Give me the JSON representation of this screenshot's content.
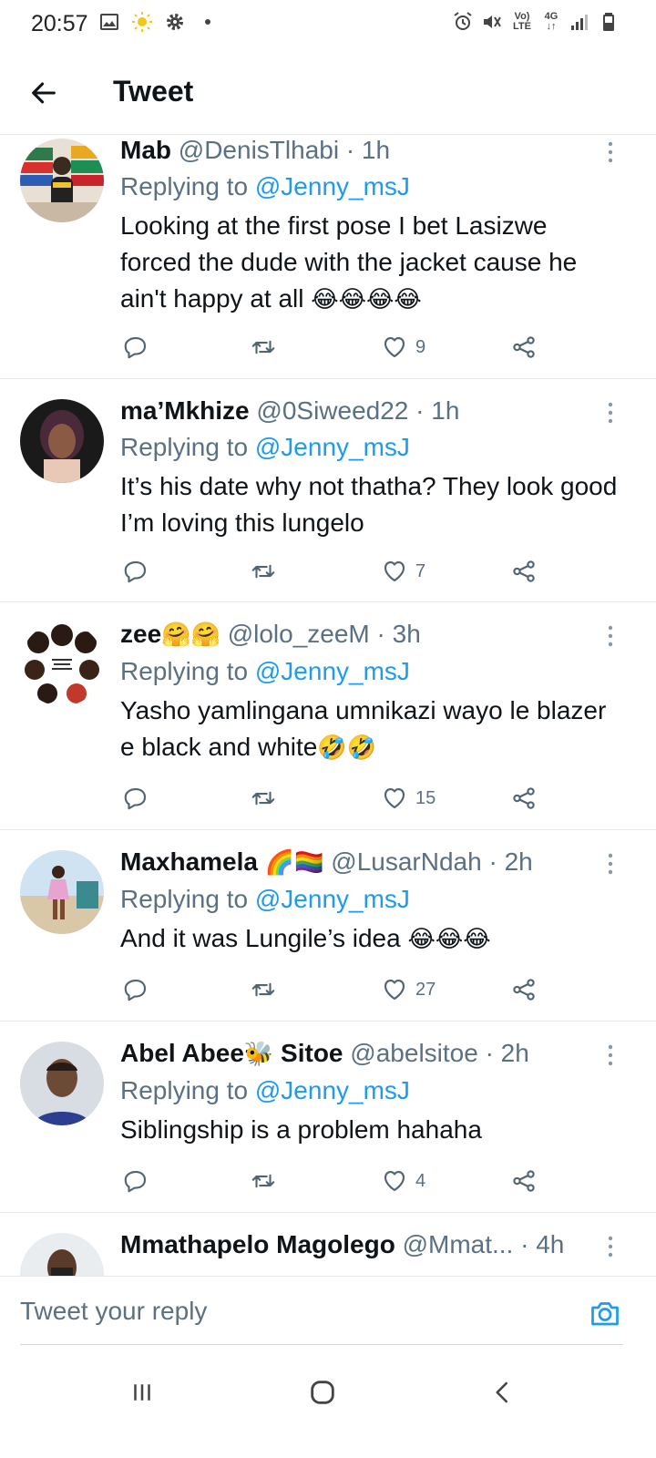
{
  "status_bar": {
    "time": "20:57",
    "network_top": "Vo)",
    "network_bottom": "LTE",
    "network_type": "4G",
    "icons_left": [
      "image-icon",
      "sun-icon",
      "gear-icon",
      "dot-icon"
    ],
    "icons_right": [
      "alarm-icon",
      "mute-icon",
      "volte-icon",
      "4g-icon",
      "signal-icon",
      "battery-icon"
    ]
  },
  "header": {
    "back_icon": "arrow-left-icon",
    "title": "Tweet"
  },
  "colors": {
    "accent": "#1d9bf0",
    "text_primary": "#0f1419",
    "text_secondary": "#5b7083",
    "divider": "#e7e9eb"
  },
  "replies": [
    {
      "display_name": "Mab",
      "name_emoji": "",
      "handle_time": "@DenisTlhabi · 1h",
      "replying_prefix": "Replying to",
      "replying_to": "@Jenny_msJ",
      "text": "Looking at the first pose I bet Lasizwe forced the dude with the jacket cause he ain't happy at all",
      "text_emoji": "😂😂😂😂",
      "likes": "9"
    },
    {
      "display_name": "ma’Mkhize",
      "name_emoji": "",
      "handle_time": "@0Siweed22 · 1h",
      "replying_prefix": "Replying to",
      "replying_to": "@Jenny_msJ",
      "text": "It’s his date why not thatha? They look good I’m loving this lungelo",
      "text_emoji": "",
      "likes": "7"
    },
    {
      "display_name": "zee",
      "name_emoji": "🤗🤗",
      "handle_time": "@lolo_zeeM · 3h",
      "replying_prefix": "Replying to",
      "replying_to": "@Jenny_msJ",
      "text": "Yasho yamlingana umnikazi wayo le blazer e black and white",
      "text_emoji": "🤣🤣",
      "likes": "15"
    },
    {
      "display_name": "Maxhamela",
      "name_emoji": "🌈🏳️‍🌈",
      "handle_time": "@LusarNdah · 2h",
      "replying_prefix": "Replying to",
      "replying_to": "@Jenny_msJ",
      "text": "And it was Lungile’s idea",
      "text_emoji": "😂😂😂",
      "likes": "27"
    },
    {
      "display_name": "Abel Abee",
      "name_emoji": "🐝",
      "display_name_2": "Sitoe",
      "handle_time": "@abelsitoe · 2h",
      "replying_prefix": "Replying to",
      "replying_to": "@Jenny_msJ",
      "text": "Siblingship is a problem hahaha",
      "text_emoji": "",
      "likes": "4"
    },
    {
      "display_name": "Mmathapelo Magolego",
      "handle_time": "@Mmat... · 4h"
    }
  ],
  "composer": {
    "placeholder": "Tweet your reply",
    "camera_icon": "camera-icon"
  },
  "nav_bar": {
    "icons": [
      "recent-apps-icon",
      "home-icon",
      "back-icon"
    ]
  }
}
